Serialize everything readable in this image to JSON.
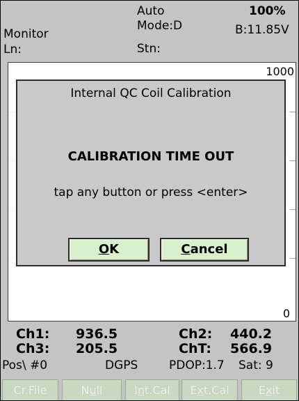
{
  "header": {
    "mode_auto": "Auto",
    "battery_percent": "100%",
    "title": "Monitor",
    "mode": "Mode:D",
    "battery_voltage": "B:11.85V",
    "line": "Ln:",
    "station": "Stn:"
  },
  "plot": {
    "y_max_label": "1000",
    "y_min_label": "0"
  },
  "dialog": {
    "title": "Internal QC Coil Calibration",
    "heading": "CALIBRATION TIME OUT",
    "message": "tap any button or press <enter>",
    "ok_mnemonic": "O",
    "ok_rest": "K",
    "cancel_mnemonic": "C",
    "cancel_rest": "ancel"
  },
  "readouts": {
    "ch1_label": "Ch1:",
    "ch1_value": "936.5",
    "ch2_label": "Ch2:",
    "ch2_value": "440.2",
    "ch3_label": "Ch3:",
    "ch3_value": "205.5",
    "cht_label": "ChT:",
    "cht_value": "566.9"
  },
  "status": {
    "pos": "Pos\\ #0",
    "gps": "DGPS",
    "pdop": "PDOP:1.7",
    "sat": "Sat: 9"
  },
  "toolbar": {
    "crfile": "Cr.File",
    "null_pre": "N",
    "null_mn": "u",
    "null_post": "ll",
    "intcal_pre": "I",
    "intcal_mn": "n",
    "intcal_post": "t.Cal",
    "extcal_pre": "E",
    "extcal_mn": "x",
    "extcal_post": "t.Cal",
    "exit_pre": "E",
    "exit_mn": "x",
    "exit_post": "it"
  },
  "colors": {
    "button_fill": "#d9f0cc",
    "toolbar_fill": "#c9d8c0",
    "window_gray": "#c4c4c4",
    "dialog_gray": "#c9c9c9"
  }
}
